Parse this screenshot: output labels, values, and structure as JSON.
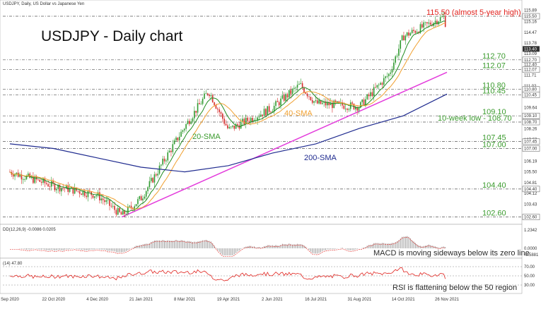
{
  "chart_data": {
    "type": "candlestick",
    "header": "USDJPY, Daily, US Dollar vs Japanese Yen",
    "title": "USDJPY - Daily chart",
    "levels": [
      {
        "value": 115.5,
        "label": "115.50 (almost 5-year high)",
        "color": "#e0231e"
      },
      {
        "value": 112.7,
        "label": "112.70",
        "color": "#3b9b2e"
      },
      {
        "value": 112.07,
        "label": "112.07",
        "color": "#3b9b2e"
      },
      {
        "value": 110.8,
        "label": "110.80",
        "color": "#3b9b2e"
      },
      {
        "value": 110.45,
        "label": "110.45",
        "color": "#3b9b2e"
      },
      {
        "value": 109.1,
        "label": "109.10",
        "color": "#3b9b2e"
      },
      {
        "value": 108.7,
        "label": "10-week low - 108.70",
        "color": "#3b9b2e"
      },
      {
        "value": 107.45,
        "label": "107.45",
        "color": "#3b9b2e"
      },
      {
        "value": 107.0,
        "label": "107.00",
        "color": "#3b9b2e"
      },
      {
        "value": 104.4,
        "label": "104.40",
        "color": "#3b9b2e"
      },
      {
        "value": 102.6,
        "label": "102.60",
        "color": "#3b9b2e"
      }
    ],
    "annotations": {
      "sma20": "20-SMA",
      "sma40": "40-SMA",
      "sma200": "200-SMA"
    },
    "x_ticks": [
      "Sep 2020",
      "22 Oct 2020",
      "4 Dec 2020",
      "21 Jan 2021",
      "8 Mar 2021",
      "19 Apr 2021",
      "2 Jun 2021",
      "16 Jul 2021",
      "31 Aug 2021",
      "14 Oct 2021",
      "26 Nov 2021"
    ],
    "price_axis": [
      "115.89",
      "115.50",
      "115.16",
      "114.47",
      "113.78",
      "113.40",
      "113.09",
      "112.70",
      "112.40",
      "112.07",
      "111.71",
      "111.02",
      "110.80",
      "110.45",
      "109.64",
      "109.10",
      "108.70",
      "108.26",
      "107.57",
      "107.45",
      "107.00",
      "106.19",
      "105.50",
      "104.81",
      "104.40",
      "104.12",
      "103.43",
      "102.60"
    ],
    "current_price": "113.40",
    "ylim": [
      102.4,
      116.0
    ],
    "ohlc_anchors": [
      {
        "x": "Sep 2020",
        "y": 105.5
      },
      {
        "x": "22 Oct 2020",
        "y": 104.6
      },
      {
        "x": "4 Dec 2020",
        "y": 104.0
      },
      {
        "x": "31 Dec 2020",
        "y": 102.7
      },
      {
        "x": "21 Jan 2021",
        "y": 103.8
      },
      {
        "x": "8 Mar 2021",
        "y": 108.4
      },
      {
        "x": "31 Mar 2021",
        "y": 110.7
      },
      {
        "x": "19 Apr 2021",
        "y": 108.2
      },
      {
        "x": "2 Jun 2021",
        "y": 109.6
      },
      {
        "x": "30 Jun 2021",
        "y": 111.1
      },
      {
        "x": "16 Jul 2021",
        "y": 109.9
      },
      {
        "x": "31 Aug 2021",
        "y": 109.7
      },
      {
        "x": "30 Sep 2021",
        "y": 111.8
      },
      {
        "x": "14 Oct 2021",
        "y": 114.2
      },
      {
        "x": "24 Nov 2021",
        "y": 115.5
      },
      {
        "x": "26 Nov 2021",
        "y": 113.4
      }
    ],
    "trendline": [
      {
        "x": "31 Dec 2020",
        "y": 102.6
      },
      {
        "x": "26 Nov 2021",
        "y": 111.9
      }
    ],
    "sma200_path": [
      {
        "x": "Sep 2020",
        "y": 107.3
      },
      {
        "x": "22 Oct 2020",
        "y": 107.0
      },
      {
        "x": "4 Dec 2020",
        "y": 106.4
      },
      {
        "x": "21 Jan 2021",
        "y": 105.8
      },
      {
        "x": "8 Mar 2021",
        "y": 105.5
      },
      {
        "x": "19 Apr 2021",
        "y": 105.9
      },
      {
        "x": "2 Jun 2021",
        "y": 106.7
      },
      {
        "x": "16 Jul 2021",
        "y": 107.3
      },
      {
        "x": "31 Aug 2021",
        "y": 108.3
      },
      {
        "x": "14 Oct 2021",
        "y": 109.1
      },
      {
        "x": "26 Nov 2021",
        "y": 110.5
      }
    ],
    "macd": {
      "header": "DD(12,26,9) -0.0086 0.0205",
      "note": "MACD is moving sideways below its zero line",
      "axis": [
        "1.2342",
        "0.0000",
        "-0.5881"
      ]
    },
    "rsi": {
      "header": "(14) 47.80",
      "note": "RSI is flattening below the 50 region",
      "axis": [
        "70.00",
        "50.00",
        "30.00"
      ]
    }
  },
  "colors": {
    "bull": "#2f9a2f",
    "bear": "#d62b2b",
    "sma20": "#1e8b1e",
    "sma40": "#f0a030",
    "sma200": "#1f2b8f",
    "trendline": "#e33bdb",
    "grid": "#555555",
    "price_tag": "#333333"
  }
}
